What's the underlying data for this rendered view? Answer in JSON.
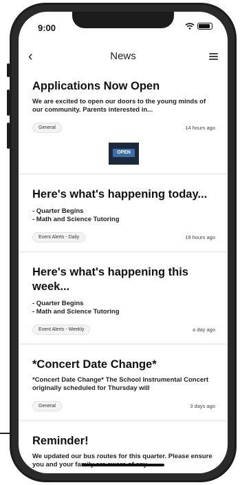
{
  "status_bar": {
    "time": "9:00"
  },
  "nav": {
    "back_glyph": "‹",
    "title": "News"
  },
  "thumbnail": {
    "label": "OPEN"
  },
  "news": [
    {
      "title": "Applications Now Open",
      "body": "We are excited to open our doors to the young minds of our community. Parents interested in...",
      "tag": "General",
      "time": "14 hours ago"
    },
    {
      "title": "Here's what's happening today...",
      "body_lines": [
        "- Quarter Begins",
        "- Math and Science Tutoring"
      ],
      "tag": "Event Alerts - Daily",
      "time": "19 hours ago"
    },
    {
      "title": "Here's what's happening this week...",
      "body_lines": [
        "- Quarter Begins",
        "- Math and Science Tutoring"
      ],
      "tag": "Event Alerts - Weekly",
      "time": "a day ago"
    },
    {
      "title": "*Concert Date Change*",
      "body": "*Concert Date Change* The School Instrumental Concert originally scheduled for Thursday will",
      "tag": "General",
      "time": "3 days ago"
    },
    {
      "title": "Reminder!",
      "body": "We updated our bus routes for this quarter. Please ensure you and your family are aware of any..."
    }
  ]
}
